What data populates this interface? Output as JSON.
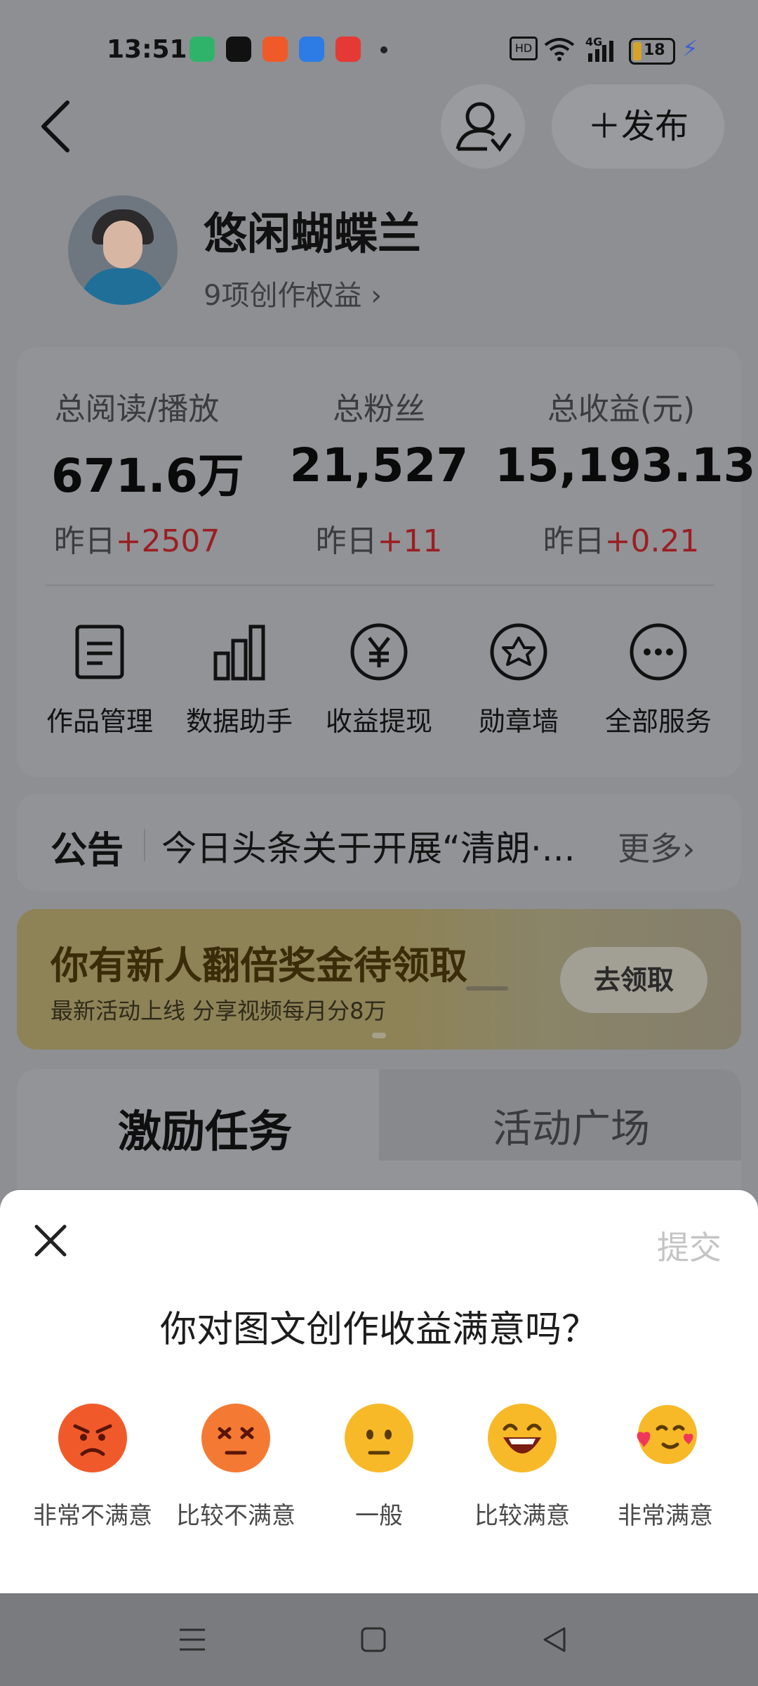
{
  "status_bar": {
    "time": "13:51",
    "battery": "18",
    "signal": "4G"
  },
  "header": {
    "publish_label": "发布"
  },
  "profile": {
    "name": "悠闲蝴蝶兰",
    "rights": "9项创作权益"
  },
  "stats": [
    {
      "label": "总阅读/播放",
      "value": "671.6万",
      "delta_prefix": "昨日",
      "delta": "+2507"
    },
    {
      "label": "总粉丝",
      "value": "21,527",
      "delta_prefix": "昨日",
      "delta": "+11"
    },
    {
      "label": "总收益(元)",
      "value": "15,193.13",
      "delta_prefix": "昨日",
      "delta": "+0.21"
    }
  ],
  "services": [
    {
      "label": "作品管理",
      "icon": "document-icon"
    },
    {
      "label": "数据助手",
      "icon": "bar-chart-icon"
    },
    {
      "label": "收益提现",
      "icon": "yen-icon"
    },
    {
      "label": "勋章墙",
      "icon": "badge-icon"
    },
    {
      "label": "全部服务",
      "icon": "more-icon"
    }
  ],
  "notice": {
    "title": "公告",
    "text": "今日头条关于开展“清朗·...",
    "more": "更多"
  },
  "banner": {
    "title": "你有新人翻倍奖金待领取",
    "subtitle": "最新活动上线 分享视频每月分8万",
    "button": "去领取"
  },
  "tabs": [
    "激励任务",
    "活动广场"
  ],
  "survey": {
    "submit": "提交",
    "question": "你对图文创作收益满意吗？",
    "options": [
      "非常不满意",
      "比较不满意",
      "一般",
      "比较满意",
      "非常满意"
    ]
  },
  "colors": {
    "sheet_bg": "#ffffff",
    "overlay": "#8e8f93",
    "delta_red": "#9a1f24",
    "face_angry": "#f05a2a",
    "face_yellow": "#f7b928"
  }
}
